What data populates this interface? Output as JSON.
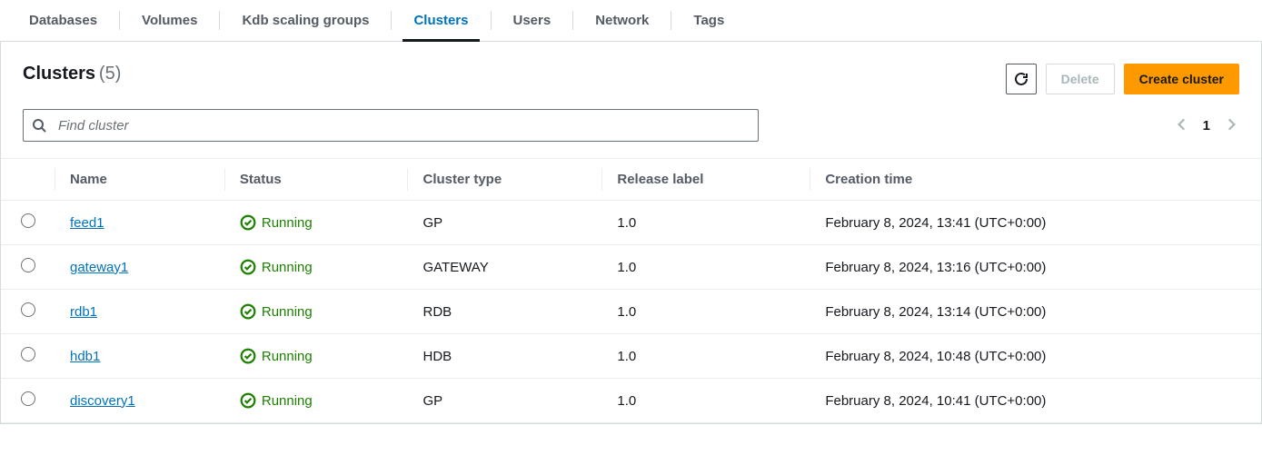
{
  "tabs": [
    {
      "label": "Databases",
      "active": false
    },
    {
      "label": "Volumes",
      "active": false
    },
    {
      "label": "Kdb scaling groups",
      "active": false
    },
    {
      "label": "Clusters",
      "active": true
    },
    {
      "label": "Users",
      "active": false
    },
    {
      "label": "Network",
      "active": false
    },
    {
      "label": "Tags",
      "active": false
    }
  ],
  "panel": {
    "title": "Clusters",
    "count": "(5)",
    "delete_label": "Delete",
    "create_label": "Create cluster"
  },
  "search": {
    "placeholder": "Find cluster"
  },
  "pagination": {
    "page": "1"
  },
  "table": {
    "headers": {
      "name": "Name",
      "status": "Status",
      "type": "Cluster type",
      "release": "Release label",
      "created": "Creation time"
    },
    "rows": [
      {
        "name": "feed1",
        "status": "Running",
        "type": "GP",
        "release": "1.0",
        "created": "February 8, 2024, 13:41 (UTC+0:00)"
      },
      {
        "name": "gateway1",
        "status": "Running",
        "type": "GATEWAY",
        "release": "1.0",
        "created": "February 8, 2024, 13:16 (UTC+0:00)"
      },
      {
        "name": "rdb1",
        "status": "Running",
        "type": "RDB",
        "release": "1.0",
        "created": "February 8, 2024, 13:14 (UTC+0:00)"
      },
      {
        "name": "hdb1",
        "status": "Running",
        "type": "HDB",
        "release": "1.0",
        "created": "February 8, 2024, 10:48 (UTC+0:00)"
      },
      {
        "name": "discovery1",
        "status": "Running",
        "type": "GP",
        "release": "1.0",
        "created": "February 8, 2024, 10:41 (UTC+0:00)"
      }
    ]
  }
}
